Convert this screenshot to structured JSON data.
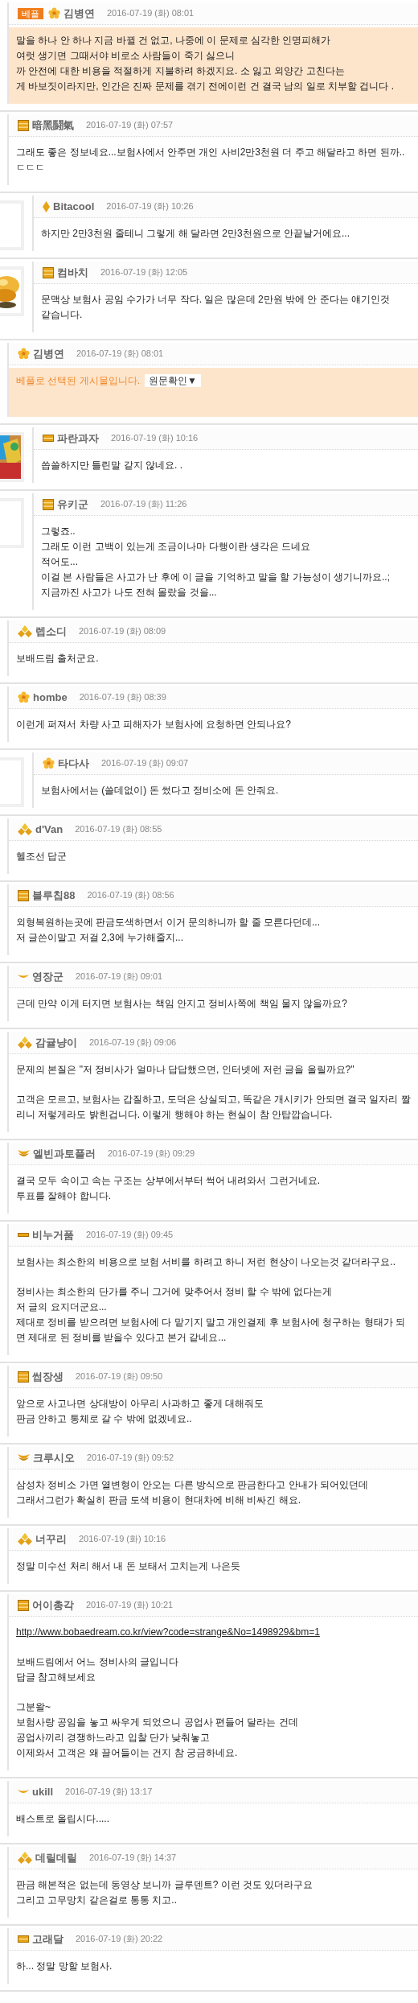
{
  "comments": [
    {
      "kind": "comment",
      "highlighted": true,
      "best_tag": "베플",
      "rank_icon": {
        "kind": "flower"
      },
      "author": "김병연",
      "time": "2016-07-19 (화) 08:01",
      "paragraphs": [
        {
          "kind": "text",
          "lines": [
            "말을 하나 안 하나 지금 바뀔 건 없고, 나중에 이 문제로 심각한 인명피해가",
            "여럿 생기면 그때서야 비로소 사람들이 죽기 싫으니",
            "까 안전에 대한 비용을 적절하게 지불하려 하겠지요. 소 잃고 외양간 고친다는",
            "게 바보짓이라지만, 인간은 진짜 문제를 겪기 전에이런 건 결국 남의 일로 치부할 겁니다 ."
          ]
        }
      ]
    },
    {
      "kind": "comment",
      "highlighted": false,
      "rank_icon": {
        "kind": "stripes"
      },
      "author": "暗黑鬪氣",
      "time": "2016-07-19 (화) 07:57",
      "paragraphs": [
        {
          "kind": "text",
          "lines": [
            "그래도 좋은 정보네요...보험사에서 안주면 개인 사비2만3천원 더 주고 해달라고 하면 된까..",
            "ㄷㄷㄷ"
          ]
        }
      ]
    },
    {
      "kind": "reply",
      "avatar": {
        "kind": "empty"
      },
      "highlighted": false,
      "rank_icon": {
        "kind": "diamond"
      },
      "author": "Bitacool",
      "time": "2016-07-19 (화) 10:26",
      "paragraphs": [
        {
          "kind": "text",
          "lines": [
            "하지만 2만3천원 줄테니 그렇게 해 달라면 2만3천원으로 안끝날거에요..."
          ]
        }
      ]
    },
    {
      "kind": "reply",
      "avatar": {
        "kind": "gold-picture"
      },
      "highlighted": false,
      "rank_icon": {
        "kind": "stripes"
      },
      "author": "컴바치",
      "time": "2016-07-19 (화) 12:05",
      "paragraphs": [
        {
          "kind": "text",
          "lines": [
            "문맥상 보험사 공임 수가가 너무 작다. 일은 많은데 2만원 밖에 안 준다는 얘기인것",
            "같습니다."
          ]
        }
      ]
    },
    {
      "kind": "comment",
      "highlighted": true,
      "rank_icon": {
        "kind": "flower"
      },
      "author": "김병연",
      "time": "2016-07-19 (화) 08:01",
      "notice": {
        "text": "베플로 선택된 게시물입니다.",
        "button": "원문확인▼"
      }
    },
    {
      "kind": "reply",
      "avatar": {
        "kind": "color-picture"
      },
      "highlighted": false,
      "rank_icon": {
        "kind": "stripes2"
      },
      "author": "파란과자",
      "time": "2016-07-19 (화) 10:16",
      "paragraphs": [
        {
          "kind": "text",
          "lines": [
            "씁쓸하지만 틀린말 같지 않네요. ."
          ]
        }
      ]
    },
    {
      "kind": "reply",
      "avatar": {
        "kind": "empty"
      },
      "highlighted": false,
      "rank_icon": {
        "kind": "stripes"
      },
      "author": "유키군",
      "time": "2016-07-19 (화) 11:26",
      "paragraphs": [
        {
          "kind": "text",
          "lines": [
            "그렇죠..",
            "그래도 이런 고백이 있는게 조금이나마 다행이란 생각은 드네요",
            "적어도...",
            "이걸 본 사람들은 사고가 난 후에 이 글을 기억하고 말을 할 가능성이 생기니까요..;",
            "지금까진 사고가 나도 전혀 몰랐을 것을..."
          ]
        }
      ]
    },
    {
      "kind": "comment",
      "highlighted": false,
      "rank_icon": {
        "kind": "gems"
      },
      "author": "렙소디",
      "time": "2016-07-19 (화) 08:09",
      "paragraphs": [
        {
          "kind": "text",
          "lines": [
            "보배드림 출처군요."
          ]
        }
      ]
    },
    {
      "kind": "comment",
      "highlighted": false,
      "rank_icon": {
        "kind": "flower"
      },
      "author": "hombe",
      "time": "2016-07-19 (화) 08:39",
      "paragraphs": [
        {
          "kind": "text",
          "lines": [
            "이런게 퍼져서 차량 사고 피해자가 보험사에 요청하면 안되나요?"
          ]
        }
      ]
    },
    {
      "kind": "reply",
      "avatar": {
        "kind": "empty"
      },
      "highlighted": false,
      "rank_icon": {
        "kind": "flower"
      },
      "author": "타다사",
      "time": "2016-07-19 (화) 09:07",
      "paragraphs": [
        {
          "kind": "text",
          "lines": [
            "보험사에서는 (쓸데없이) 돈 썼다고 정비소에 돈 안줘요."
          ]
        }
      ]
    },
    {
      "kind": "comment",
      "highlighted": false,
      "rank_icon": {
        "kind": "gems"
      },
      "author": "d'Van",
      "time": "2016-07-19 (화) 08:55",
      "paragraphs": [
        {
          "kind": "text",
          "lines": [
            "헬조선 답군"
          ]
        }
      ]
    },
    {
      "kind": "comment",
      "highlighted": false,
      "rank_icon": {
        "kind": "stripes"
      },
      "author": "블루칩88",
      "time": "2016-07-19 (화) 08:56",
      "paragraphs": [
        {
          "kind": "text",
          "lines": [
            "외형복원하는곳에 판금도색하면서 이거 문의하니까 할 줄 모른다던데...",
            "저 글쓴이말고 저걸 2,3에 누가해줄지..."
          ]
        }
      ]
    },
    {
      "kind": "comment",
      "highlighted": false,
      "rank_icon": {
        "kind": "wing"
      },
      "author": "영장군",
      "time": "2016-07-19 (화) 09:01",
      "paragraphs": [
        {
          "kind": "text",
          "lines": [
            "근데 만약 이게 터지면 보험사는 책임 안지고 정비사쪽에 책임 물지 않을까요?"
          ]
        }
      ]
    },
    {
      "kind": "comment",
      "highlighted": false,
      "rank_icon": {
        "kind": "gems"
      },
      "author": "감귤냥이",
      "time": "2016-07-19 (화) 09:06",
      "paragraphs": [
        {
          "kind": "text",
          "lines": [
            "문제의 본질은 \"저 정비사가 얼마나 답답했으면, 인터넷에 저런 글을 올릴까요?\""
          ]
        },
        {
          "kind": "text",
          "lines": [
            "고객은 모르고, 보험사는 갑질하고, 도덕은 상실되고, 똑같은 개시키가 안되면 결국 일자리 짤리니 저렇게라도 밝힌겁니다. 이렇게 행해야 하는 현실이 참 안탑깝습니다."
          ]
        }
      ]
    },
    {
      "kind": "comment",
      "highlighted": false,
      "rank_icon": {
        "kind": "wings"
      },
      "author": "엘빈과토플러",
      "time": "2016-07-19 (화) 09:29",
      "paragraphs": [
        {
          "kind": "text",
          "lines": [
            "결국 모두 속이고 속는 구조는 상부에서부터 썩어 내려와서 그런거네요.",
            "투표를 잘해야 합니다."
          ]
        }
      ]
    },
    {
      "kind": "comment",
      "highlighted": false,
      "rank_icon": {
        "kind": "bar"
      },
      "author": "비누거품",
      "time": "2016-07-19 (화) 09:45",
      "paragraphs": [
        {
          "kind": "text",
          "lines": [
            "보험사는 최소한의 비용으로 보험 서비를 하려고 하니 저런 현상이 나오는것 같더라구요.."
          ]
        },
        {
          "kind": "text",
          "lines": [
            "정비사는 최소한의 단가를 주니 그거에 맞추어서 정비 할 수 밖에 없다는게",
            "저 글의 요지더군요...",
            "제대로 정비를 받으려면 보험사에 다 맡기지 말고 개인결제 후 보험사에 청구하는 형태가 되면 제대로 된 정비를 받을수 있다고 본거 같네요..."
          ]
        }
      ]
    },
    {
      "kind": "comment",
      "highlighted": false,
      "rank_icon": {
        "kind": "stripes"
      },
      "author": "썹장생",
      "time": "2016-07-19 (화) 09:50",
      "paragraphs": [
        {
          "kind": "text",
          "lines": [
            "앞으로 사고나면 상대방이 아무리 사과하고 좋게 대해줘도",
            "판금 안하고 통체로 갈 수 밖에 없겠네요.."
          ]
        }
      ]
    },
    {
      "kind": "comment",
      "highlighted": false,
      "rank_icon": {
        "kind": "wings"
      },
      "author": "크루시오",
      "time": "2016-07-19 (화) 09:52",
      "paragraphs": [
        {
          "kind": "text",
          "lines": [
            "삼성차 정비소 가면 열변형이 안오는 다른 방식으로 판금한다고 안내가 되어있던데",
            "그래서그런가 확실히 판금 도색 비용이 현대차에 비해 비싸긴 해요."
          ]
        }
      ]
    },
    {
      "kind": "comment",
      "highlighted": false,
      "rank_icon": {
        "kind": "gems"
      },
      "author": "너꾸리",
      "time": "2016-07-19 (화) 10:16",
      "paragraphs": [
        {
          "kind": "text",
          "lines": [
            "정말 미수선 처리 해서 내 돈 보태서 고치는게 나은듯"
          ]
        }
      ]
    },
    {
      "kind": "comment",
      "highlighted": false,
      "rank_icon": {
        "kind": "stripes"
      },
      "author": "어이총각",
      "time": "2016-07-19 (화) 10:21",
      "paragraphs": [
        {
          "kind": "link",
          "lines": [
            "http://www.bobaedream.co.kr/view?code=strange&No=1498929&bm=1"
          ]
        },
        {
          "kind": "text",
          "lines": [
            "보배드림에서 어느 정비사의 글입니다",
            "답글 참고해보세요"
          ]
        },
        {
          "kind": "text",
          "lines": [
            "그분왈~",
            "보험사랑 공임을 놓고 싸우게 되었으니 공업사 편들어 달라는 건데",
            "공업사끼리 경쟁하느라고 입찰 단가 낮춰놓고",
            "이제와서 고객은 왜 끌어들이는 건지 참 궁금하네요."
          ]
        }
      ]
    },
    {
      "kind": "comment",
      "highlighted": false,
      "rank_icon": {
        "kind": "wing"
      },
      "author": "ukill",
      "time": "2016-07-19 (화) 13:17",
      "paragraphs": [
        {
          "kind": "text",
          "lines": [
            "배스트로 올립시다....."
          ]
        }
      ]
    },
    {
      "kind": "comment",
      "highlighted": false,
      "rank_icon": {
        "kind": "gems"
      },
      "author": "데릴데릴",
      "time": "2016-07-19 (화) 14:37",
      "paragraphs": [
        {
          "kind": "text",
          "lines": [
            "판금 해본적은 없는데 동영상 보니까 글루덴트? 이런 것도 있더라구요",
            "그리고 고무망치 같은걸로 통통 치고.."
          ]
        }
      ]
    },
    {
      "kind": "comment",
      "highlighted": false,
      "rank_icon": {
        "kind": "stripes2"
      },
      "author": "고래달",
      "time": "2016-07-19 (화) 20:22",
      "paragraphs": [
        {
          "kind": "text",
          "lines": [
            "하... 정말 망할 보험사."
          ]
        }
      ]
    }
  ]
}
